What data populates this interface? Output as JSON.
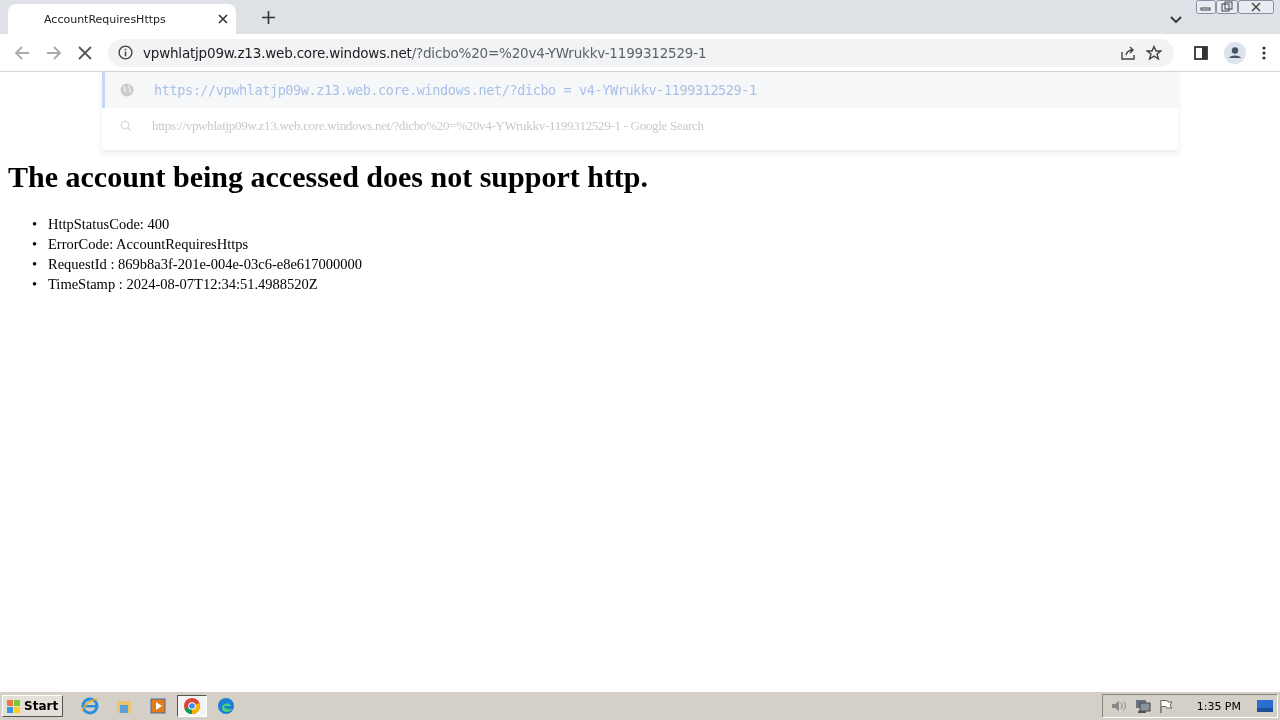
{
  "tab": {
    "title": "AccountRequiresHttps",
    "selected": true
  },
  "address_bar": {
    "host": "vpwhlatjp09w.z13.web.core.windows.net",
    "path": "/?dicbo%20=%20v4-YWrukkv-1199312529-1"
  },
  "suggestions": [
    {
      "kind": "url",
      "text": "https://vpwhlatjp09w.z13.web.core.windows.net/?dicbo = v4-YWrukkv-1199312529-1",
      "selected": true
    },
    {
      "kind": "search",
      "text": "https://vpwhlatjp09w.z13.web.core.windows.net/?dicbo%20=%20v4-YWrukkv-1199312529-1",
      "suffix": "- Google Search",
      "selected": false
    }
  ],
  "page": {
    "heading": "The account being accessed does not support http.",
    "items": [
      {
        "bullet": "•",
        "text": "HttpStatusCode: 400"
      },
      {
        "bullet": "•",
        "text": "ErrorCode: AccountRequiresHttps"
      },
      {
        "bullet": "•",
        "text": "RequestId : 869b8a3f-201e-004e-03c6-e8e617000000"
      },
      {
        "bullet": "•",
        "text": "TimeStamp : 2024-08-07T12:34:51.4988520Z"
      }
    ]
  },
  "taskbar": {
    "start": "Start",
    "apps": [
      {
        "kind": "ie",
        "selected": false
      },
      {
        "kind": "explorer",
        "selected": false
      },
      {
        "kind": "media",
        "selected": false
      },
      {
        "kind": "chrome",
        "selected": true
      },
      {
        "kind": "edge",
        "selected": false
      }
    ],
    "clock": "1:35 PM"
  }
}
